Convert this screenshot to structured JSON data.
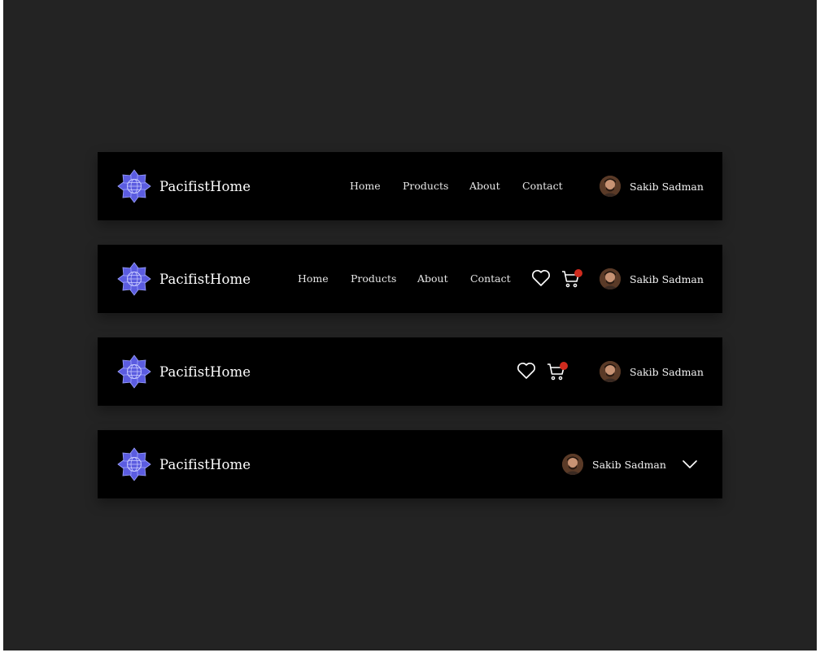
{
  "brand": {
    "name": "PacifistHome",
    "logo_icon": "flower-globe-logo",
    "logo_color": "#5b5ce0"
  },
  "nav_links": [
    "Home",
    "Products",
    "About",
    "Contact"
  ],
  "user": {
    "name": "Sakib Sadman",
    "avatar_icon": "user-avatar"
  },
  "icons": {
    "wishlist": "heart-icon",
    "cart": "cart-icon",
    "menu": "chevron-down-icon"
  },
  "colors": {
    "background": "#232323",
    "navbar": "#000000",
    "badge": "#d02b1e",
    "text": "#ffffff"
  },
  "navbars": [
    {
      "variant": "links-and-user"
    },
    {
      "variant": "links-icons-and-user"
    },
    {
      "variant": "icons-and-user"
    },
    {
      "variant": "user-dropdown"
    }
  ]
}
